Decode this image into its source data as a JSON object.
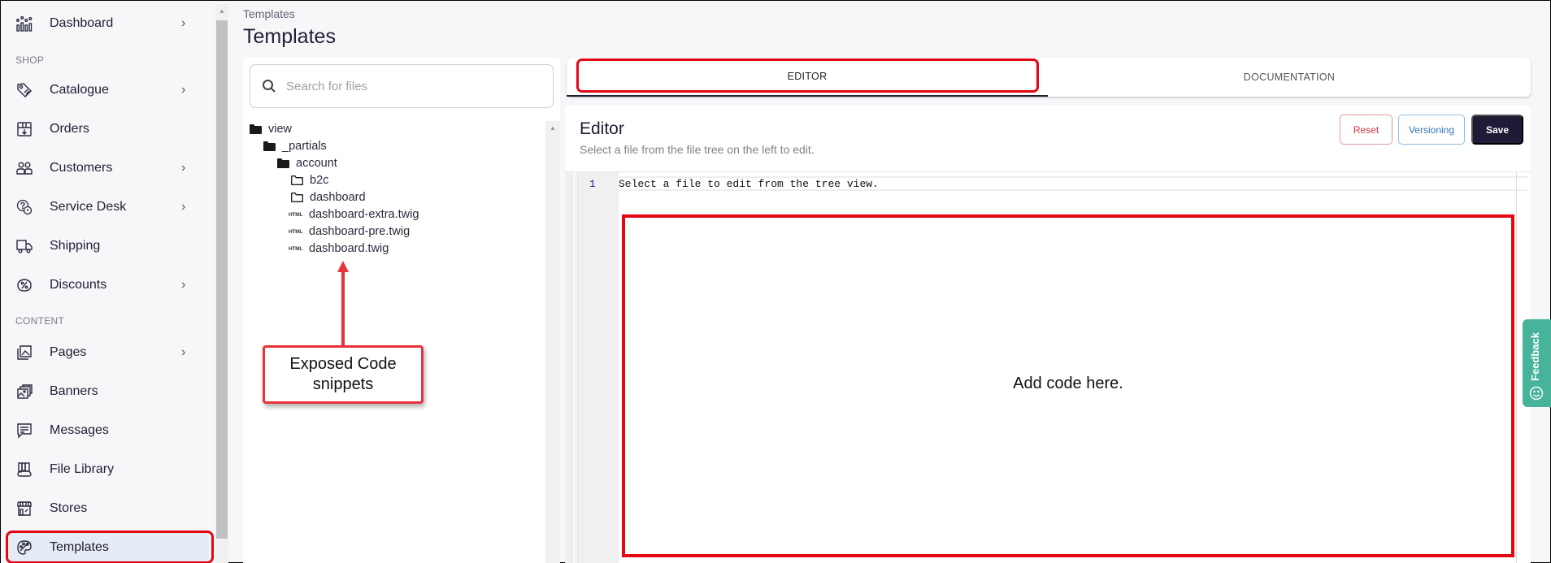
{
  "sidebar": {
    "items": [
      {
        "label": "Dashboard",
        "icon": "dashboard-icon",
        "has_children": true
      },
      {
        "label": "Catalogue",
        "icon": "tag-icon",
        "has_children": true
      },
      {
        "label": "Orders",
        "icon": "box-icon",
        "has_children": false
      },
      {
        "label": "Customers",
        "icon": "users-icon",
        "has_children": true
      },
      {
        "label": "Service Desk",
        "icon": "help-chat-icon",
        "has_children": true
      },
      {
        "label": "Shipping",
        "icon": "truck-icon",
        "has_children": false
      },
      {
        "label": "Discounts",
        "icon": "discount-icon",
        "has_children": true
      },
      {
        "label": "Pages",
        "icon": "pages-icon",
        "has_children": true
      },
      {
        "label": "Banners",
        "icon": "banners-icon",
        "has_children": false
      },
      {
        "label": "Messages",
        "icon": "message-icon",
        "has_children": false
      },
      {
        "label": "File Library",
        "icon": "file-library-icon",
        "has_children": false
      },
      {
        "label": "Stores",
        "icon": "store-icon",
        "has_children": false
      },
      {
        "label": "Templates",
        "icon": "palette-icon",
        "has_children": false,
        "active": true
      }
    ],
    "sections": {
      "shop": "SHOP",
      "content": "CONTENT"
    },
    "chevron": "›"
  },
  "header": {
    "breadcrumb": "Templates",
    "title": "Templates"
  },
  "file_tree": {
    "search_placeholder": "Search for files",
    "search_value": "",
    "nodes": [
      {
        "label": "view",
        "type": "folder-open",
        "depth": 0
      },
      {
        "label": "_partials",
        "type": "folder-open",
        "depth": 1
      },
      {
        "label": "account",
        "type": "folder-open",
        "depth": 2
      },
      {
        "label": "b2c",
        "type": "folder",
        "depth": 3
      },
      {
        "label": "dashboard",
        "type": "folder",
        "depth": 3
      },
      {
        "label": "dashboard-extra.twig",
        "type": "html-file",
        "depth": 3
      },
      {
        "label": "dashboard-pre.twig",
        "type": "html-file",
        "depth": 3
      },
      {
        "label": "dashboard.twig",
        "type": "html-file",
        "depth": 3
      }
    ],
    "html_icon_text": "HTML"
  },
  "annotations": {
    "callout": "Exposed Code snippets",
    "editor_area": "Add code here.",
    "color": "#e30613"
  },
  "tabs": [
    {
      "label": "EDITOR",
      "active": true
    },
    {
      "label": "DOCUMENTATION",
      "active": false
    }
  ],
  "editor": {
    "title": "Editor",
    "subtitle": "Select a file from the file tree on the left to edit.",
    "buttons": {
      "reset": "Reset",
      "versioning": "Versioning",
      "save": "Save"
    },
    "lines": [
      {
        "number": "1",
        "text": "Select a file to edit from the tree view."
      }
    ]
  },
  "feedback": {
    "label": "Feedback"
  },
  "colors": {
    "primary_dark": "#1f1b36",
    "reset_red": "#d0333f",
    "versioning_blue": "#2f76c0",
    "feedback_green": "#46b39a"
  }
}
